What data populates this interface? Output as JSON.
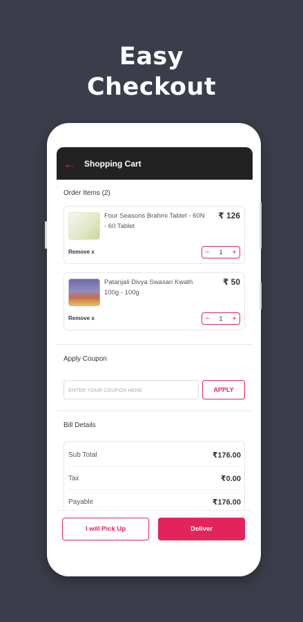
{
  "headline": {
    "line1": "Easy",
    "line2": "Checkout"
  },
  "appbar": {
    "title": "Shopping Cart",
    "back_icon": "arrow-left-icon"
  },
  "order": {
    "heading": "Order Items (2)",
    "items": [
      {
        "name": "Four Seasons Brahmi Tablet - 60N - 60 Tablet",
        "price": "₹ 126",
        "remove_label": "Remove x",
        "qty": "1",
        "minus": "−",
        "plus": "+"
      },
      {
        "name": "Patanjali Divya Swasari Kwath 100g - 100g",
        "price": "₹ 50",
        "remove_label": "Remove x",
        "qty": "1",
        "minus": "−",
        "plus": "+"
      }
    ]
  },
  "coupon": {
    "heading": "Apply Coupon",
    "placeholder": "ENTER YOUR COUPON HERE",
    "apply_label": "APPLY"
  },
  "bill": {
    "heading": "Bill Details",
    "rows": [
      {
        "label": "Sub Total",
        "value": "₹176.00"
      },
      {
        "label": "Tax",
        "value": "₹0.00"
      },
      {
        "label": "Payable",
        "value": "₹176.00"
      }
    ]
  },
  "actions": {
    "pickup_label": "I will Pick Up",
    "deliver_label": "Deliver"
  },
  "colors": {
    "accent": "#e3245c",
    "background": "#3b3e4a",
    "appbar": "#222222"
  }
}
